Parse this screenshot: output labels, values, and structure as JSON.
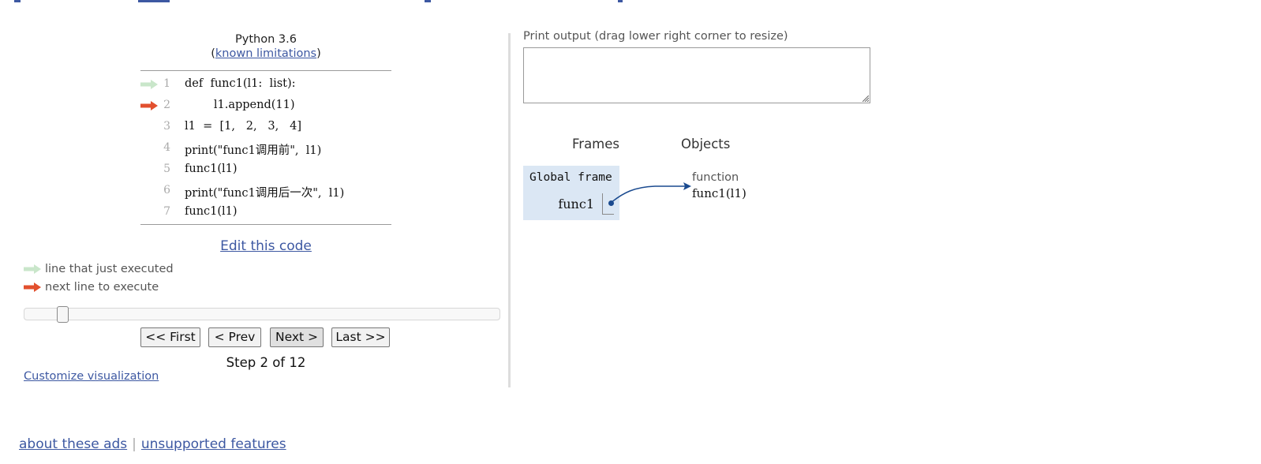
{
  "header": {
    "language": "Python 3.6",
    "open_paren": "(",
    "limitations_link": "known limitations",
    "close_paren": ")"
  },
  "code": {
    "lines": [
      {
        "num": "1",
        "text": "def  func1(l1:  list):",
        "arrow": "prev"
      },
      {
        "num": "2",
        "text": "        l1.append(11)",
        "arrow": "next"
      },
      {
        "num": "3",
        "text": "l1  =  [1,   2,   3,   4]",
        "arrow": ""
      },
      {
        "num": "4",
        "text": "print(\"func1调用前\",  l1)",
        "arrow": ""
      },
      {
        "num": "5",
        "text": "func1(l1)",
        "arrow": ""
      },
      {
        "num": "6",
        "text": "print(\"func1调用后一次\",  l1)",
        "arrow": ""
      },
      {
        "num": "7",
        "text": "func1(l1)",
        "arrow": ""
      }
    ]
  },
  "edit_link": "Edit this code",
  "legend": {
    "prev": "line that just executed",
    "next": "next line to execute"
  },
  "colors": {
    "prev_arrow": "#c9e6ca",
    "next_arrow": "#e2502e",
    "link": "#3d58a2",
    "frame_bg": "#dbe7f4",
    "pointer": "#1a4a8f"
  },
  "navigation": {
    "first": "<< First",
    "prev": "< Prev",
    "next": "Next >",
    "last": "Last >>",
    "step_text": "Step 2 of 12",
    "current_step": 2,
    "total_steps": 12
  },
  "customize_link": "Customize visualization",
  "print_output": {
    "label": "Print output (drag lower right corner to resize)",
    "content": ""
  },
  "visualization": {
    "frames_header": "Frames",
    "objects_header": "Objects",
    "frame_title": "Global frame",
    "variables": [
      {
        "name": "func1"
      }
    ],
    "object_type": "function",
    "object_value": "func1(l1)"
  },
  "footer": {
    "ads_link": "about these ads",
    "separator": "|",
    "unsupported_link": "unsupported features"
  }
}
